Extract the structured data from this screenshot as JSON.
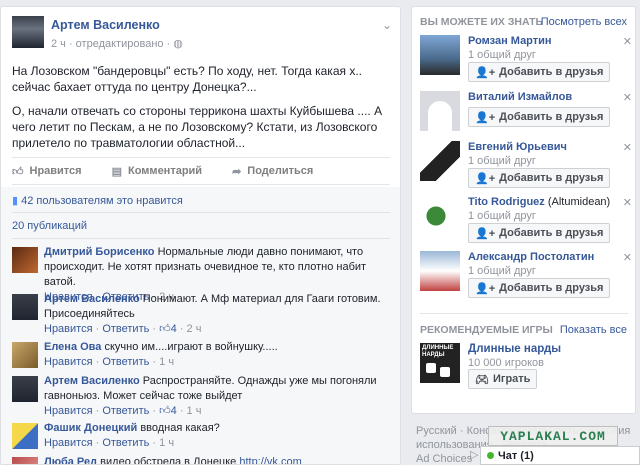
{
  "post": {
    "author": "Артем Василенко",
    "meta": "2 ч · отредактировано · ",
    "paragraphs": [
      "На Лозовском \"бандеровцы\" есть? По ходу, нет. Тогда какая х.. сейчас бахает оттуда по центру Донецка?...",
      "О, начали отвечать со стороны терриконa шахты Куйбышева .... А чего летит по Пескам, а не по Лозовскому? Кстати, из Лозовского прилетело по травматологии областной..."
    ],
    "actions": {
      "like": "Нравится",
      "comment": "Комментарий",
      "share": "Поделиться"
    },
    "likes_text": "42 пользователям это нравится",
    "shares_text": "20 публикаций",
    "comments": [
      {
        "name": "Дмитрий Борисенко",
        "text": "Нормальные люди давно понимают, что происходит. Не хотят признать очевидное те, кто плотно набит ватой.",
        "like": "Нравится",
        "reply": "Ответить",
        "likes": "",
        "time": "2 ч"
      },
      {
        "name": "Артем Василенко",
        "text": "Понимают. А Мф материал для Гааги готовим. Присоединяйтесь",
        "like": "Нравится",
        "reply": "Ответить",
        "likes": "4",
        "time": "2 ч"
      },
      {
        "name": "Елена Ова",
        "text": "скучно им....играют в войнушку.....",
        "like": "Нравится",
        "reply": "Ответить",
        "likes": "",
        "time": "1 ч"
      },
      {
        "name": "Артем Василенко",
        "text": "Распространяйте. Однажды уже мы погоняли гавноньюз. Может сейчас тоже выйдет",
        "like": "Нравится",
        "reply": "Ответить",
        "likes": "4",
        "time": "1 ч"
      },
      {
        "name": "Фашик Донецкий",
        "text": "вводная какая?",
        "like": "Нравится",
        "reply": "Ответить",
        "likes": "",
        "time": "1 ч"
      },
      {
        "name": "Люба Ред",
        "text": "видео обстрела в Донецке",
        "link": "http://vk.com",
        "like": "",
        "reply": "",
        "likes": "",
        "time": ""
      }
    ]
  },
  "sidebar": {
    "pymk_title": "Вы можете их знать",
    "see_all": "Посмотреть всех",
    "friends": [
      {
        "name": "Ромзан Мартин",
        "sub": "",
        "mutual": "1 общий друг",
        "button": "Добавить в друзья"
      },
      {
        "name": "Виталий Измайлов",
        "sub": "",
        "mutual": "",
        "button": "Добавить в друзья"
      },
      {
        "name": "Евгений Юрьевич",
        "sub": "",
        "mutual": "1 общий друг",
        "button": "Добавить в друзья"
      },
      {
        "name": "Tito Rodriguez",
        "sub": " (Altumidean)",
        "mutual": "1 общий друг",
        "button": "Добавить в друзья"
      },
      {
        "name": "Александр Постолатин",
        "sub": "",
        "mutual": "1 общий друг",
        "button": "Добавить в друзья"
      }
    ],
    "games_title": "Рекомендуемые игры",
    "games_see_all": "Показать все",
    "game": {
      "name": "Длинные нарды",
      "players": "10 000 игроков",
      "button": "Играть",
      "logo_text": "ДЛИННЫЕ НАРДЫ"
    }
  },
  "footer": {
    "line1": "Русский · Конфиденциальность · Условия",
    "line2": "использования · Реклама",
    "line3": "Ad Choices"
  },
  "watermark": "YAPLAKAL.COM",
  "chat": {
    "label": "Чат (1)"
  },
  "colors": {
    "link": "#365899",
    "meta": "#90949c",
    "online": "#42b72a"
  }
}
